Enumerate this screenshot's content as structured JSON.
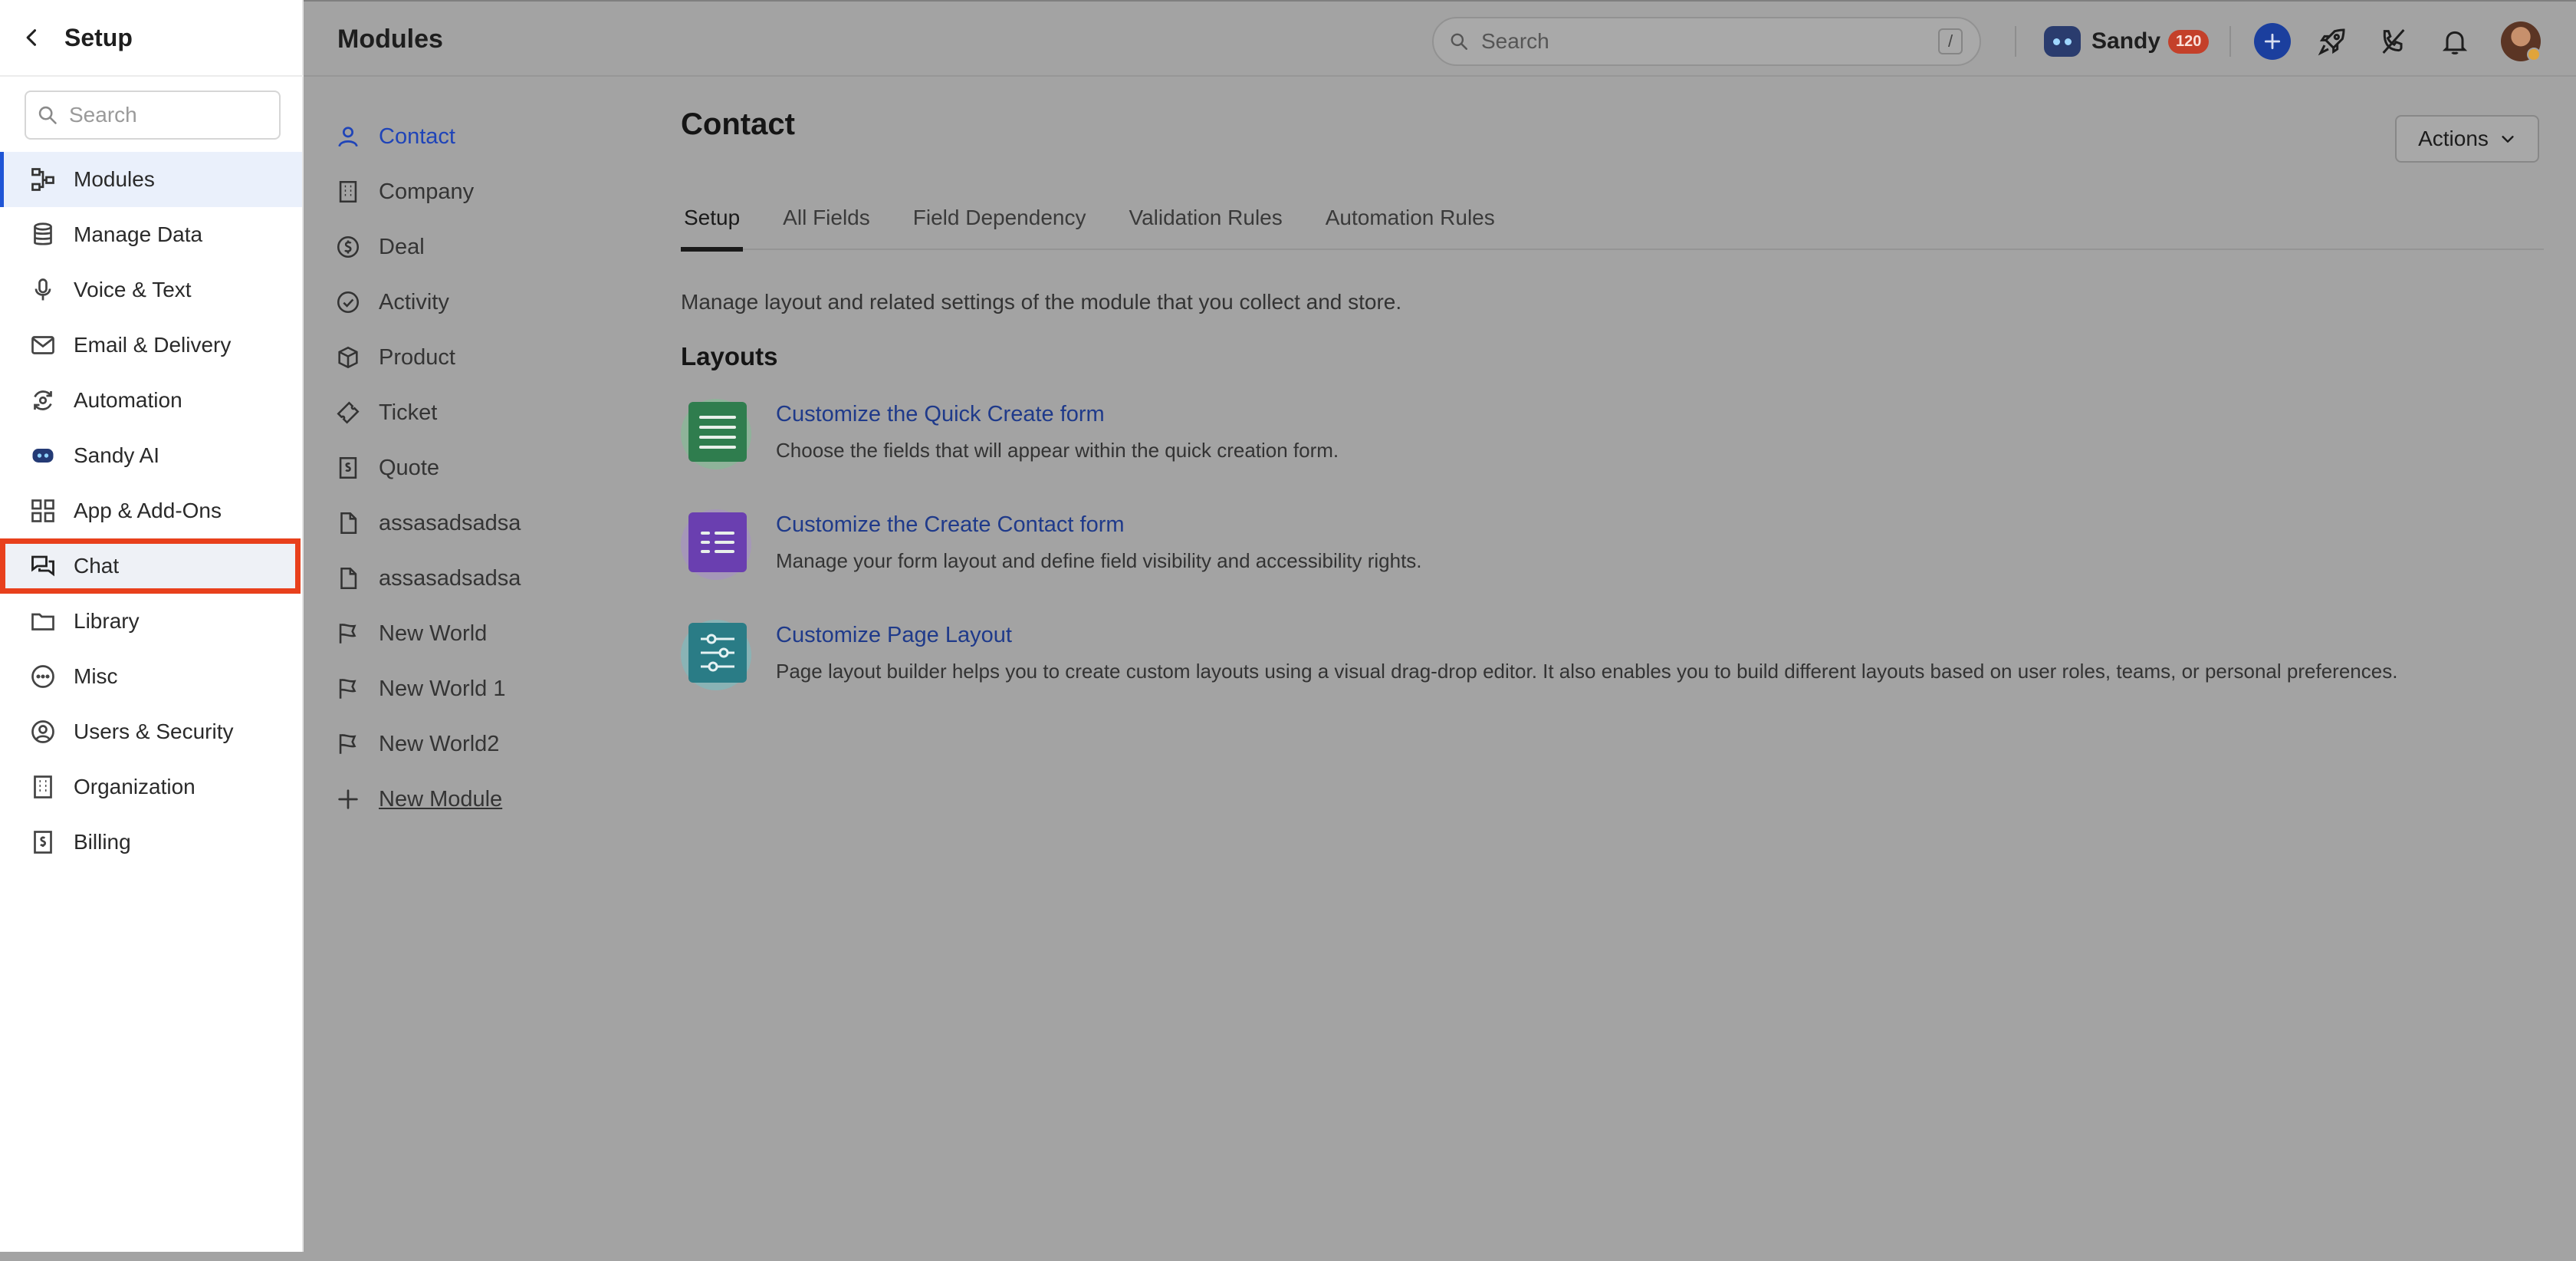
{
  "sidebar": {
    "title": "Setup",
    "search_placeholder": "Search",
    "items": [
      {
        "label": "Modules",
        "icon": "modules-icon"
      },
      {
        "label": "Manage Data",
        "icon": "database-icon"
      },
      {
        "label": "Voice & Text",
        "icon": "microphone-icon"
      },
      {
        "label": "Email & Delivery",
        "icon": "mail-icon"
      },
      {
        "label": "Automation",
        "icon": "automation-icon"
      },
      {
        "label": "Sandy AI",
        "icon": "sandy-ai-icon"
      },
      {
        "label": "App & Add-Ons",
        "icon": "apps-grid-icon"
      },
      {
        "label": "Chat",
        "icon": "chat-icon"
      },
      {
        "label": "Library",
        "icon": "folder-icon"
      },
      {
        "label": "Misc",
        "icon": "more-icon"
      },
      {
        "label": "Users & Security",
        "icon": "user-circle-icon"
      },
      {
        "label": "Organization",
        "icon": "building-icon"
      },
      {
        "label": "Billing",
        "icon": "billing-icon"
      }
    ],
    "active": "Modules",
    "highlighted": "Chat"
  },
  "topbar": {
    "title": "Modules",
    "search_placeholder": "Search",
    "search_shortcut": "/",
    "assistant_name": "Sandy",
    "assistant_badge": "120"
  },
  "modules": {
    "items": [
      {
        "label": "Contact",
        "icon": "person-icon"
      },
      {
        "label": "Company",
        "icon": "building-icon"
      },
      {
        "label": "Deal",
        "icon": "dollar-icon"
      },
      {
        "label": "Activity",
        "icon": "check-circle-icon"
      },
      {
        "label": "Product",
        "icon": "box-icon"
      },
      {
        "label": "Ticket",
        "icon": "ticket-icon"
      },
      {
        "label": "Quote",
        "icon": "quote-icon"
      },
      {
        "label": "assasadsadsa",
        "icon": "file-icon"
      },
      {
        "label": "assasadsadsa",
        "icon": "file-icon"
      },
      {
        "label": "New World",
        "icon": "flag-icon"
      },
      {
        "label": "New World 1",
        "icon": "flag-icon"
      },
      {
        "label": "New World2",
        "icon": "flag-icon"
      }
    ],
    "new_module_label": "New Module",
    "active": "Contact"
  },
  "content": {
    "title": "Contact",
    "actions_label": "Actions",
    "tabs": [
      "Setup",
      "All Fields",
      "Field Dependency",
      "Validation Rules",
      "Automation Rules"
    ],
    "active_tab": "Setup",
    "description": "Manage layout and related settings of the module that you collect and store.",
    "layouts_heading": "Layouts",
    "layouts": [
      {
        "title": "Customize the Quick Create form",
        "desc": "Choose the fields that will appear within the quick creation form.",
        "color": "#2f7d4e",
        "halo": "#8fb39a"
      },
      {
        "title": "Customize the Create Contact form",
        "desc": "Manage your form layout and define field visibility and accessibility rights.",
        "color": "#6a3fb0",
        "halo": "#a597b8"
      },
      {
        "title": "Customize Page Layout",
        "desc": "Page layout builder helps you to create custom layouts using a visual drag-drop editor. It also enables you to build different layouts based on user roles, teams, or personal preferences.",
        "color": "#2a7c86",
        "halo": "#8ab3b5"
      }
    ]
  },
  "colors": {
    "accent": "#1f55d6",
    "highlight_border": "#e8401c",
    "overlay": "#a3a3a3"
  }
}
